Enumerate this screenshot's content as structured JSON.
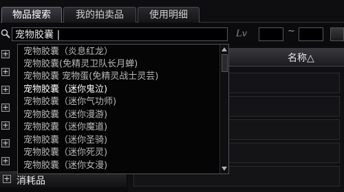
{
  "tabs": [
    {
      "label": "物品搜索",
      "active": true
    },
    {
      "label": "我的拍卖品",
      "active": false
    },
    {
      "label": "使用明细",
      "active": false
    }
  ],
  "search": {
    "value": "宠物胶囊 |",
    "lv_label": "Lv",
    "tilde": "~"
  },
  "results": {
    "name_header": "名称△"
  },
  "dropdown": {
    "items": [
      "宠物胶囊（炎息红龙）",
      "宠物胶囊(免精灵卫队长月蝉)",
      "宠物胶囊 宠物蛋(免精灵战士灵芸)",
      "宠物胶囊（迷你鬼泣)",
      "宠物胶囊（迷你气功师)",
      "宠物胶囊（迷你漫游)",
      "宠物胶囊（迷你魔道)",
      "宠物胶囊（迷你圣骑)",
      "宠物胶囊（迷你死灵)",
      "宠物胶囊（迷你女漫)"
    ],
    "highlighted_index": 3
  },
  "category": {
    "bottom_label": "消耗品",
    "plus_glyph": "+"
  },
  "icons": {
    "search": "search-icon",
    "scroll_up": "scroll-up-icon",
    "scroll_down": "scroll-down-icon"
  }
}
